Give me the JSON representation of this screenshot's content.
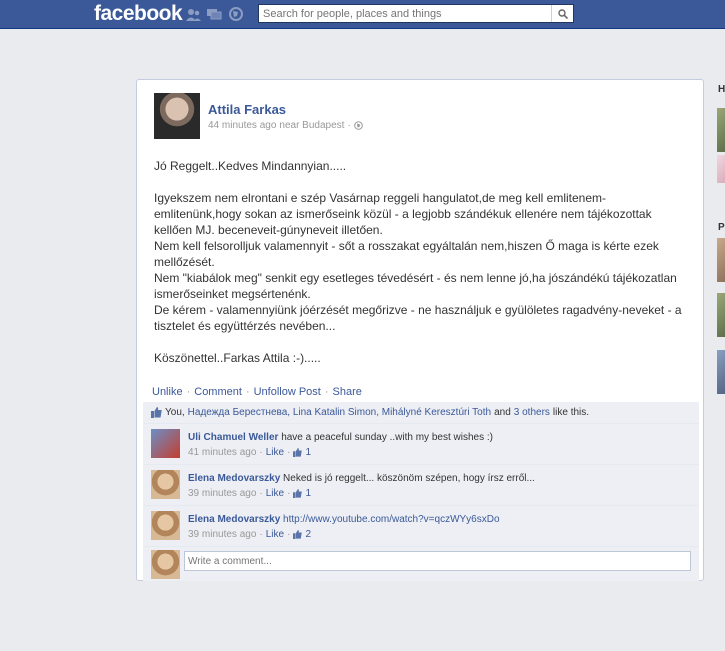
{
  "topbar": {
    "logo": "facebook",
    "search_placeholder": "Search for people, places and things"
  },
  "sidebar": {
    "letters": [
      "H",
      "P"
    ]
  },
  "post": {
    "author": "Attila Farkas",
    "time": "44 minutes ago",
    "location": "near Budapest",
    "separator": "·",
    "paragraphs": [
      "Jó Reggelt..Kedves Mindannyian.....",
      "",
      "Igyekszem nem elrontani e szép Vasárnap reggeli hangulatot,de meg kell emlitenem-emlitenünk,hogy sokan az ismerőseink közül - a legjobb szándékuk ellenére nem tájékozottak kellően MJ. beceneveit-gúnyneveit illetően.",
      "Nem kell felsorolljuk valamennyit - sőt a rosszakat egyáltalán nem,hiszen Ő maga is kérte ezek mellőzését.",
      "Nem \"kiabálok meg\" senkit egy esetleges tévedésért - és nem lenne jó,ha jószándékú tájékozatlan ismerőseinket megsértenénk.",
      "De kérem - valamennyiünk jóérzését megőrizve - ne használjuk e gyülöletes ragadvény-neveket - a tisztelet és együttérzés nevében...",
      "",
      "Köszönettel..Farkas Attila :-)....."
    ],
    "actions": [
      "Unlike",
      "Comment",
      "Unfollow Post",
      "Share"
    ],
    "likes": {
      "you": "You,",
      "names": "Надежда Берестнева, Lina Katalin Simon, Mihályné Keresztúri Toth",
      "and": "and",
      "others": "3 others",
      "suffix": "like this."
    }
  },
  "comments": [
    {
      "name": "Uli Chamuel Weller",
      "text": "have a peaceful sunday ..with my best wishes :)",
      "time": "41 minutes ago",
      "like": "Like",
      "count": "1"
    },
    {
      "name": "Elena Medovarszky",
      "text": "Neked is jó reggelt... köszönöm szépen, hogy írsz erről...",
      "time": "39 minutes ago",
      "like": "Like",
      "count": "1"
    },
    {
      "name": "Elena Medovarszky",
      "text": "http://www.youtube.com/watch?v=qczWYy6sxDo",
      "time": "39 minutes ago",
      "like": "Like",
      "count": "2"
    }
  ],
  "write_comment_placeholder": "Write a comment...",
  "colors": {
    "brand": "#3b5998",
    "background": "#e9ebee",
    "ufi": "#edeff4"
  }
}
